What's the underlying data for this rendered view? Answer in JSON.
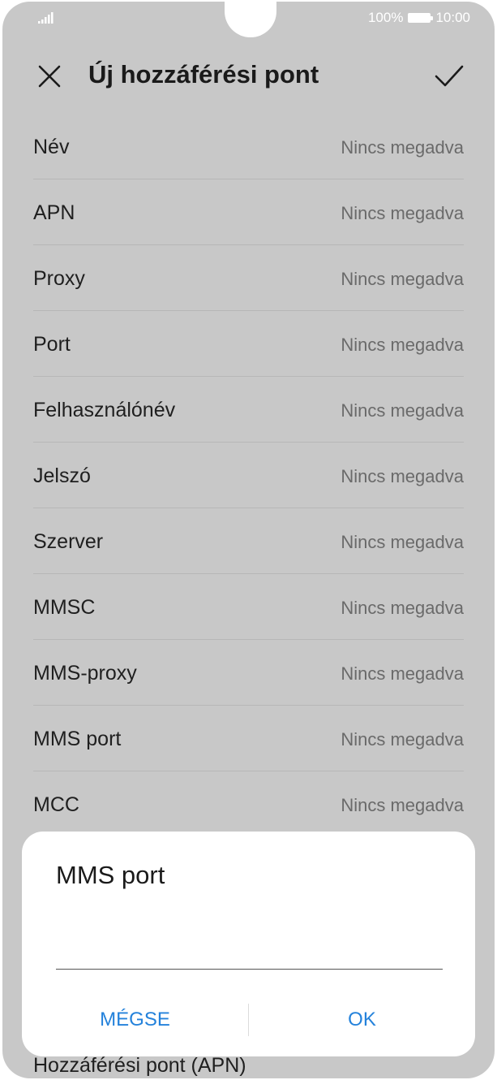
{
  "status_bar": {
    "battery": "100%",
    "time": "10:00"
  },
  "toolbar": {
    "title": "Új hozzáférési pont"
  },
  "fields": [
    {
      "label": "Név",
      "value": "Nincs megadva"
    },
    {
      "label": "APN",
      "value": "Nincs megadva"
    },
    {
      "label": "Proxy",
      "value": "Nincs megadva"
    },
    {
      "label": "Port",
      "value": "Nincs megadva"
    },
    {
      "label": "Felhasználónév",
      "value": "Nincs megadva"
    },
    {
      "label": "Jelszó",
      "value": "Nincs megadva"
    },
    {
      "label": "Szerver",
      "value": "Nincs megadva"
    },
    {
      "label": "MMSC",
      "value": "Nincs megadva"
    },
    {
      "label": "MMS-proxy",
      "value": "Nincs megadva"
    },
    {
      "label": "MMS port",
      "value": "Nincs megadva"
    },
    {
      "label": "MCC",
      "value": "Nincs megadva"
    }
  ],
  "partial_row": {
    "label": "Hozzáférési pont (APN)"
  },
  "dialog": {
    "title": "MMS port",
    "input_value": "",
    "cancel_label": "MÉGSE",
    "ok_label": "OK"
  },
  "colors": {
    "accent": "#2482db",
    "dim_background": "#c8c8c8"
  }
}
